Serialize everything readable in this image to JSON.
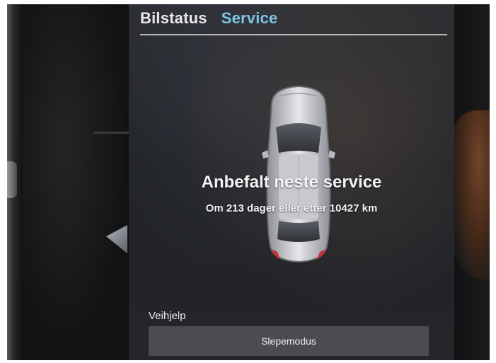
{
  "tabs": [
    {
      "label": "Bilstatus",
      "active": false
    },
    {
      "label": "Service",
      "active": true
    }
  ],
  "service": {
    "headline": "Anbefalt neste service",
    "detail": "Om 213 dager eller etter 10427 km"
  },
  "roadside": {
    "section_label": "Veihjelp",
    "tow_mode_button": "Slepemodus"
  },
  "colors": {
    "active_tab": "#7fc4e8",
    "text": "#f0f0f2",
    "button_bg": "#4a4c52"
  },
  "icons": [
    "car-top-view-icon"
  ]
}
